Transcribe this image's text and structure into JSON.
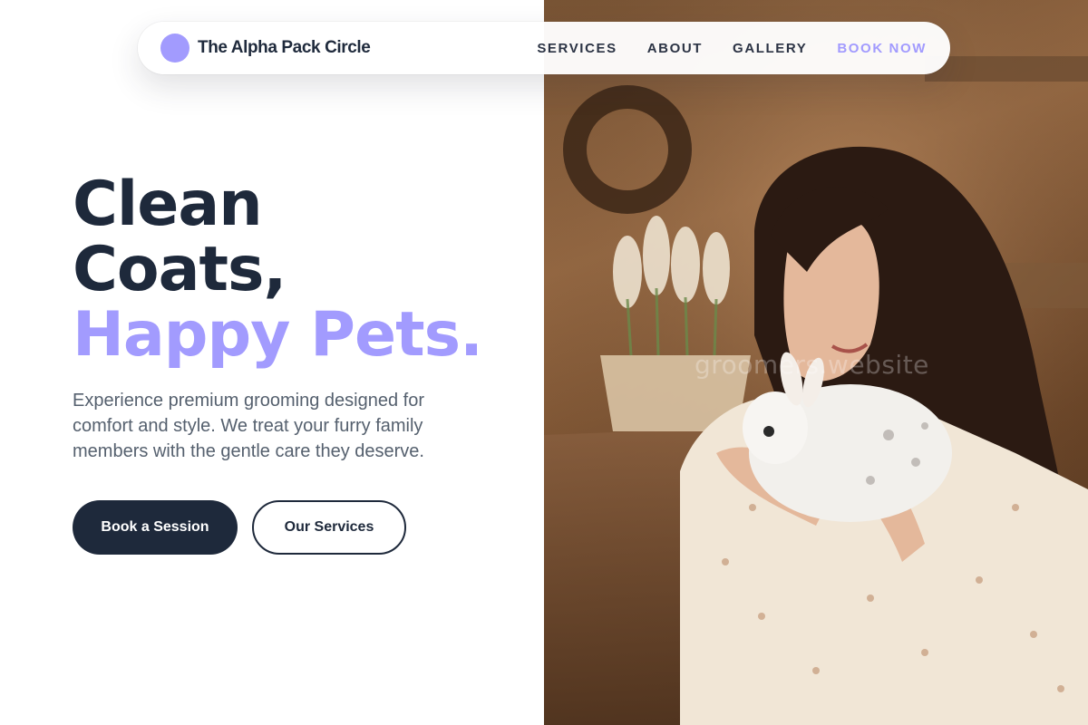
{
  "brand": {
    "name": "The Alpha Pack Circle",
    "accent_color": "#a29bfe",
    "logo_icon": "circle-logo-icon"
  },
  "nav": {
    "items": [
      {
        "label": "SERVICES"
      },
      {
        "label": "ABOUT"
      },
      {
        "label": "GALLERY"
      },
      {
        "label": "BOOK NOW"
      }
    ]
  },
  "hero": {
    "headline_line1": "Clean",
    "headline_line2": "Coats,",
    "headline_accent": "Happy Pets.",
    "description": "Experience premium grooming designed for comfort and style. We treat your furry family members with the gentle care they deserve.",
    "primary_button": "Book a Session",
    "secondary_button": "Our Services",
    "dark_color": "#1e293b"
  },
  "photo": {
    "watermark": "groomers.website"
  }
}
